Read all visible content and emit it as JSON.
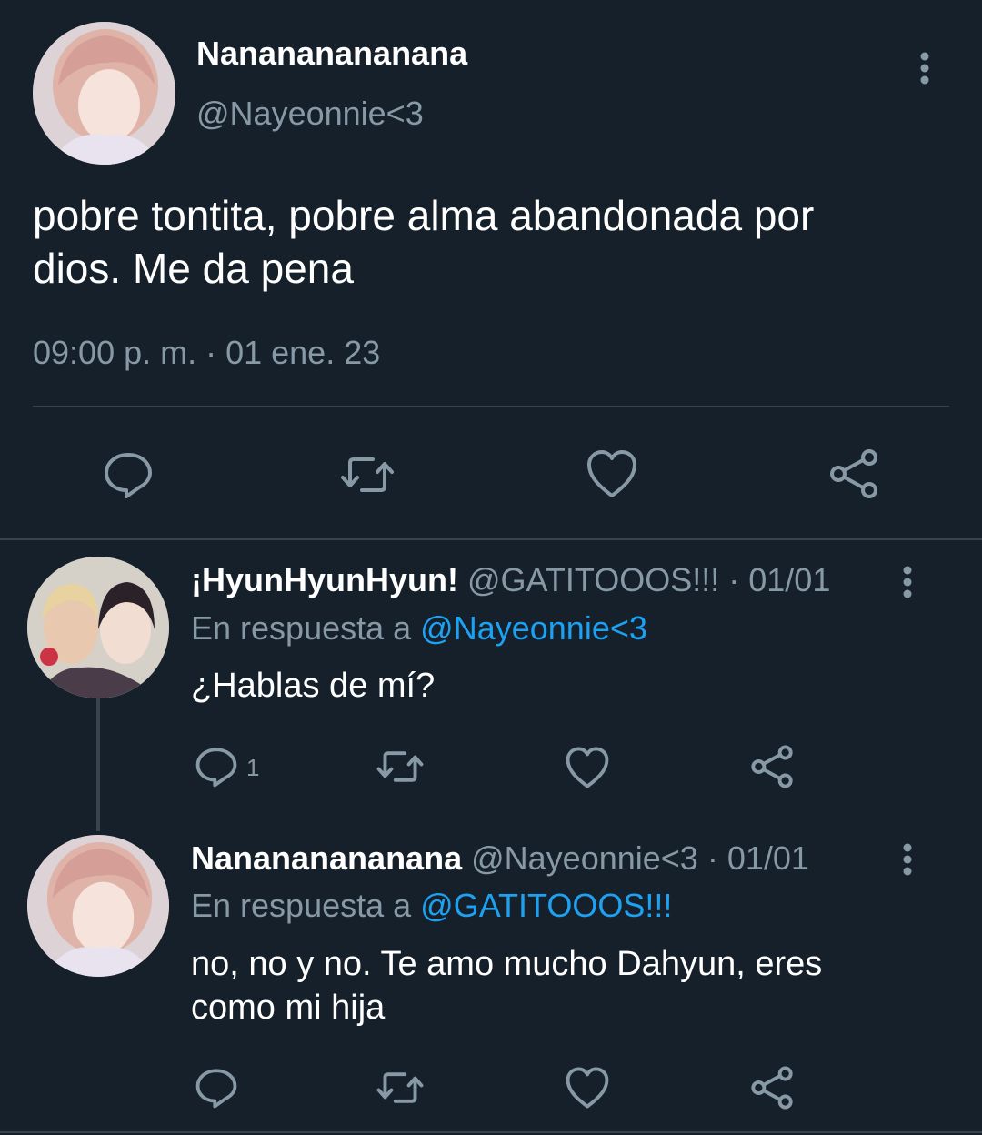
{
  "main_tweet": {
    "display_name": "Nanananananana",
    "handle": "@Nayeonnie<3",
    "text_line1": "pobre tontita, pobre alma abandonada por",
    "text_line2": "dios. Me da pena",
    "timestamp": "09:00 p. m. · 01 ene. 23",
    "avatar_icon": "avatar-pink-hair-girl"
  },
  "replies": [
    {
      "display_name": "¡HyunHyunHyun!",
      "handle": "@GATITOOOS!!!",
      "date": "· 01/01",
      "reply_prefix": "En respuesta a",
      "reply_to": "@Nayeonnie<3",
      "text_line1": "¿Hablas de mí?",
      "text_line2": "",
      "reply_count": "1",
      "avatar_icon": "avatar-two-girls"
    },
    {
      "display_name": "Nanananananana",
      "handle": "@Nayeonnie<3",
      "date": "· 01/01",
      "reply_prefix": "En respuesta a",
      "reply_to": "@GATITOOOS!!!",
      "text_line1": "no, no y no. Te amo mucho Dahyun, eres",
      "text_line2": "como mi hija",
      "reply_count": "",
      "avatar_icon": "avatar-pink-hair-girl"
    }
  ],
  "colors": {
    "background": "#15202b",
    "muted": "#8899a6",
    "link": "#1da1f2",
    "divider": "#38444d"
  }
}
